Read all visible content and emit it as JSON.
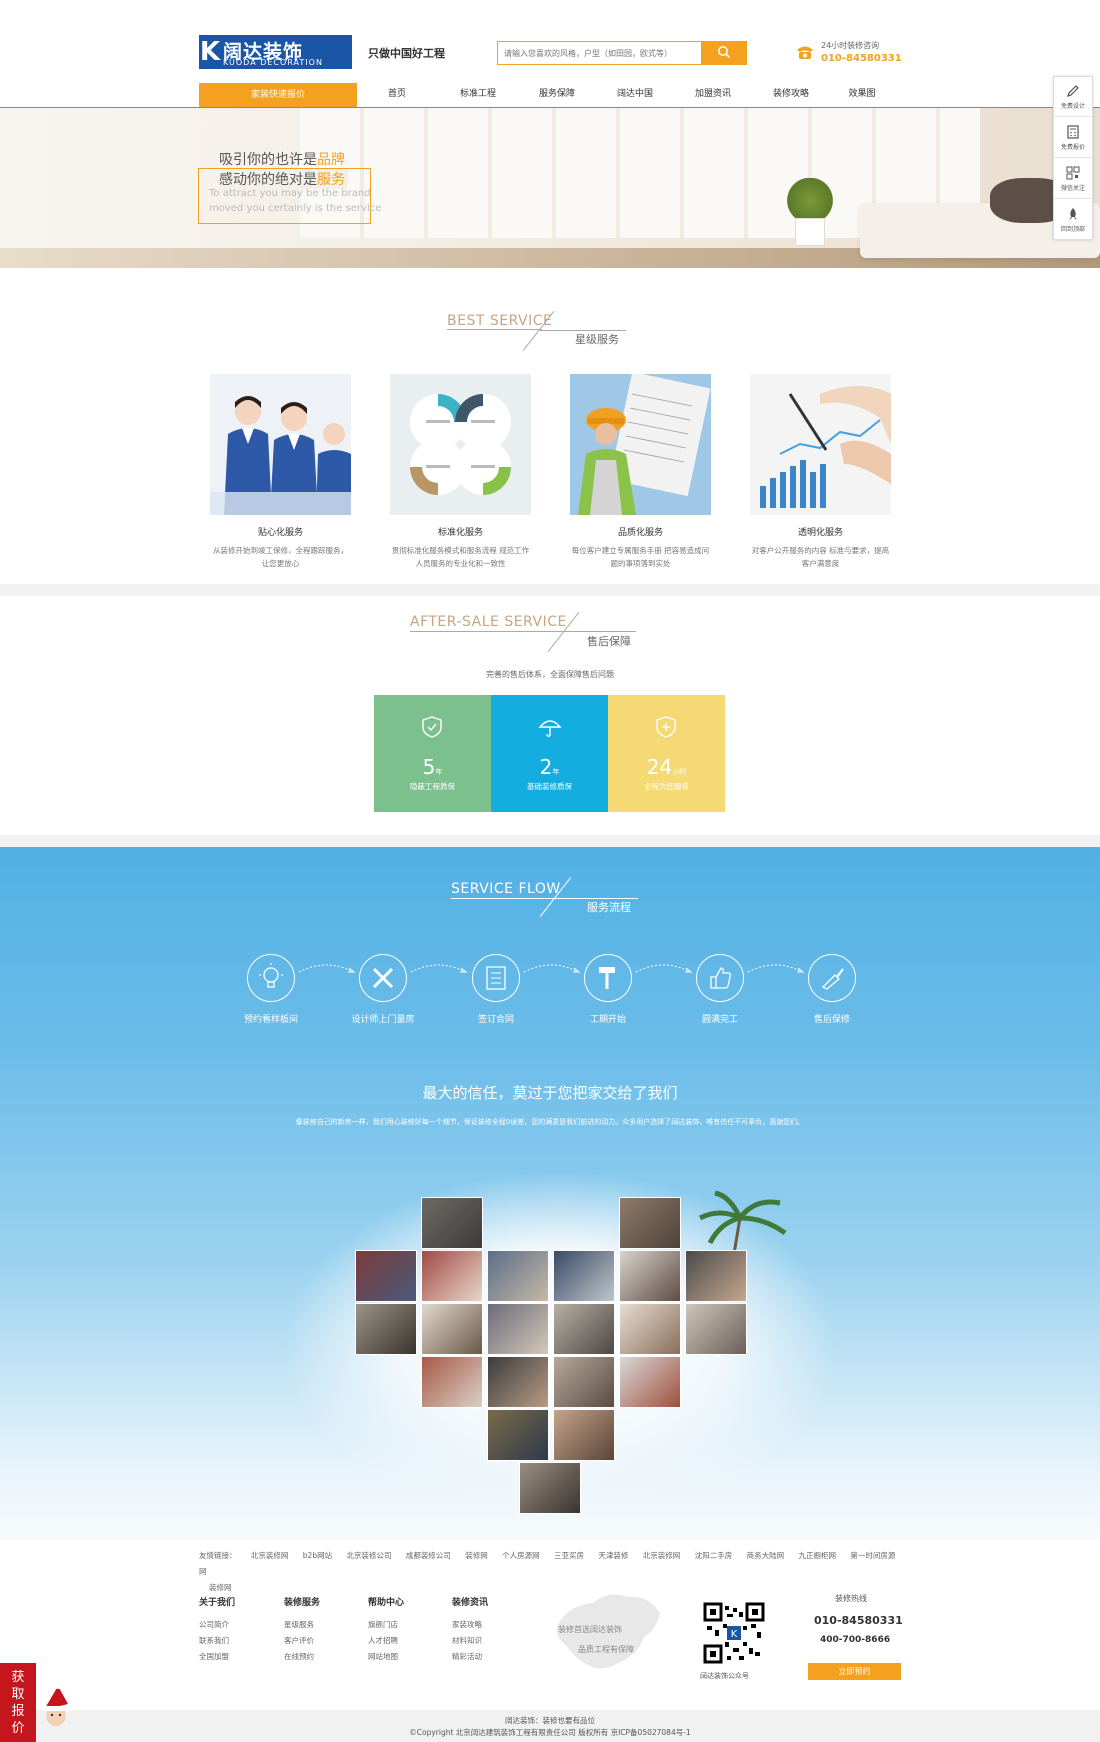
{
  "header": {
    "logo_cn": "阔达装饰",
    "logo_en": "KUODA DECORATION",
    "logo_mark": "K",
    "slogan": "只做中国好工程",
    "search_placeholder": "请输入您喜欢的风格，户型（如田园，欧式等）",
    "hotline_label": "24小时装修咨询",
    "hotline_number": "010-84580331"
  },
  "nav": {
    "quote_button": "家装快速报价",
    "items": [
      "首页",
      "标准工程",
      "服务保障",
      "阔达中国",
      "加盟资讯",
      "装修攻略",
      "效果图"
    ]
  },
  "sidebar": {
    "items": [
      "免费设计",
      "免费报价",
      "微信关注",
      "回到顶部"
    ]
  },
  "hero": {
    "line1_prefix": "吸引你的也许是",
    "line1_highlight": "品牌",
    "line2_prefix": "感动你的绝对是",
    "line2_highlight": "服务",
    "en_line1": "To attract you may be the brand",
    "en_line2": "moved you certainly is the service"
  },
  "best_service": {
    "title_en": "BEST SERVICE",
    "title_cn": "星级服务",
    "cards": [
      {
        "title": "贴心化服务",
        "desc": "从装修开始到竣工保修，全程跟踪服务，让您更放心"
      },
      {
        "title": "标准化服务",
        "desc": "贯彻标准化服务模式和服务流程 规范工作人员服务的专业化和一致性"
      },
      {
        "title": "品质化服务",
        "desc": "每位客户建立专属服务手册 把容易造成问题的事项落到实处"
      },
      {
        "title": "透明化服务",
        "desc": "对客户公开服务的内容 标准与要求，提高客户满意度"
      }
    ]
  },
  "after_sale": {
    "title_en": "AFTER-SALE SERVICE",
    "title_cn": "售后保障",
    "subtitle": "完善的售后体系，全面保障售后问题",
    "boxes": [
      {
        "num": "5",
        "unit": "年",
        "label": "隐蔽工程质保",
        "color": "#7cc08e"
      },
      {
        "num": "2",
        "unit": "年",
        "label": "基础装修质保",
        "color": "#13aedf"
      },
      {
        "num": "24",
        "unit": "小时",
        "label": "全程为您服务",
        "color": "#f4d974"
      }
    ]
  },
  "flow": {
    "title_en": "SERVICE FLOW",
    "title_cn": "服务流程",
    "steps": [
      "预约看样板间",
      "设计师上门量房",
      "签订合同",
      "工期开始",
      "圆满完工",
      "售后保修"
    ]
  },
  "trust": {
    "title": "最大的信任，莫过于您把家交给了我们",
    "desc": "像装修自己的新房一样，我们用心装修好每一个细节，保证装修全程0误差，您的满意是我们前进的动力。众多用户选择了阔达装饰，唯有信任不可辜负，感谢您们。"
  },
  "footer": {
    "links_label": "友情链接：",
    "links": [
      "北京装修网",
      "b2b网站",
      "北京装修公司",
      "成都装修公司",
      "装修网",
      "个人房源网",
      "三亚买房",
      "天津装修",
      "北京装修网",
      "沈阳二手房",
      "商务大陆网",
      "九正橱柜网",
      "第一时间房源网",
      "装修网"
    ],
    "columns": [
      {
        "title": "关于我们",
        "items": [
          "公司简介",
          "联系我们",
          "全国加盟"
        ]
      },
      {
        "title": "装修服务",
        "items": [
          "星级服务",
          "客户评价",
          "在线预约"
        ]
      },
      {
        "title": "帮助中心",
        "items": [
          "旗舰门店",
          "人才招聘",
          "网站地图"
        ]
      },
      {
        "title": "装修资讯",
        "items": [
          "家装攻略",
          "材料知识",
          "精彩活动"
        ]
      }
    ],
    "map_text1": "装修首选阔达装饰",
    "map_text2": "品质工程有保障",
    "qr_label": "阔达装饰公众号",
    "hotline_label": "装修热线",
    "hotline1": "010-84580331",
    "hotline2": "400-700-8666",
    "book_button": "立即预约",
    "copy1": "阔达装饰：装修也要有品位",
    "copy2": "©Copyright 北京阔达建筑装饰工程有限责任公司 版权所有 京ICP备05027084号-1"
  },
  "float_quote": {
    "label": "获取报价"
  }
}
